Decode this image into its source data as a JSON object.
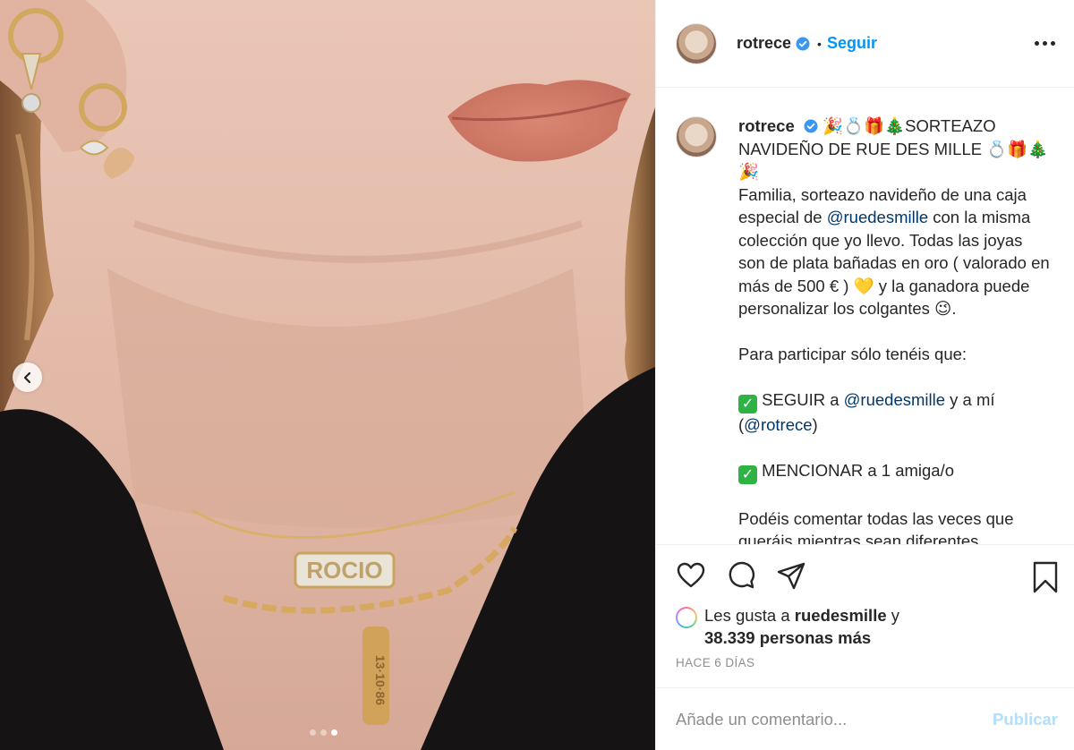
{
  "post": {
    "carousel": {
      "total_slides": 3,
      "active_slide": 3
    },
    "header": {
      "username": "rotrece",
      "separator": "•",
      "follow_label": "Seguir"
    },
    "caption": {
      "username": "rotrece",
      "title_line": "🎉💍🎁🎄SORTEAZO NAVIDEÑO DE RUE DES MILLE 💍🎁🎄🎉",
      "intro_1": "Familia, sorteazo navideño de una caja especial de ",
      "intro_mention": "@ruedesmille",
      "intro_2": " con la misma colección que yo llevo. Todas las joyas son de plata bañadas en oro ( valorado en más de 500 € ) 💛 y la ganadora puede personalizar los colgantes 😉.",
      "participate": "Para participar sólo tenéis que:",
      "step1_check": "✓",
      "step1_a": " SEGUIR a ",
      "step1_mention1": "@ruedesmille",
      "step1_b": " y a mí (",
      "step1_mention2": "@rotrece",
      "step1_c": ")",
      "step2_check": "✓",
      "step2": " MENCIONAR a 1 amiga/o",
      "footer_line1": "Podéis comentar todas las veces que",
      "footer_line2": "queráis mientras sean diferentes"
    },
    "likes": {
      "prefix": "Les gusta a ",
      "liker": "ruedesmille",
      "middle": " y",
      "count_text": "38.339 personas más"
    },
    "timestamp": "HACE 6 DÍAS",
    "comment": {
      "placeholder": "Añade un comentario...",
      "publish_label": "Publicar"
    },
    "photo": {
      "necklace_name": "ROCIO",
      "pendant_date": "13·10·86"
    },
    "colors": {
      "accent": "#0095f6",
      "mention": "#00376b",
      "muted": "#8e8e8e",
      "publish_disabled": "#b2dffc"
    },
    "icons": [
      "chevron-left-icon",
      "verified-badge-icon",
      "more-options-icon",
      "heart-icon",
      "comment-icon",
      "share-icon",
      "bookmark-icon"
    ]
  }
}
